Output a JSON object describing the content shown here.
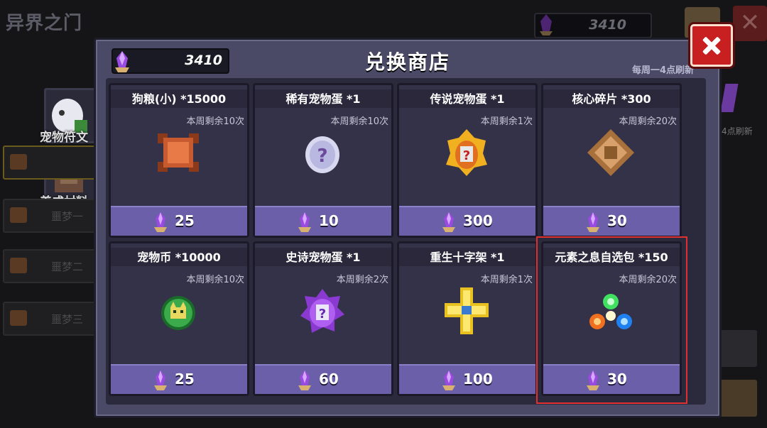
{
  "background": {
    "title": "异界之门",
    "currency_value": "3410",
    "side_menu": [
      {
        "label": "宠物符文"
      },
      {
        "label": "养成材料"
      }
    ],
    "side_tabs": [
      {
        "label": "噩梦一"
      },
      {
        "label": "噩梦二"
      },
      {
        "label": "噩梦三"
      }
    ],
    "right_note": "4点刷新"
  },
  "shop": {
    "title": "兑换商店",
    "currency_value": "3410",
    "refresh_note": "每周一4点刷新",
    "close_icon": "close-icon",
    "items": [
      {
        "name": "狗粮(小) *15000",
        "remain": "本周剩余10次",
        "price": "25",
        "icon": "dog-food-icon"
      },
      {
        "name": "稀有宠物蛋 *1",
        "remain": "本周剩余10次",
        "price": "10",
        "icon": "rare-egg-icon"
      },
      {
        "name": "传说宠物蛋 *1",
        "remain": "本周剩余1次",
        "price": "300",
        "icon": "legendary-egg-icon"
      },
      {
        "name": "核心碎片 *300",
        "remain": "本周剩余20次",
        "price": "30",
        "icon": "core-fragment-icon"
      },
      {
        "name": "宠物币 *10000",
        "remain": "本周剩余10次",
        "price": "25",
        "icon": "pet-coin-icon"
      },
      {
        "name": "史诗宠物蛋 *1",
        "remain": "本周剩余2次",
        "price": "60",
        "icon": "epic-egg-icon"
      },
      {
        "name": "重生十字架 *1",
        "remain": "本周剩余1次",
        "price": "100",
        "icon": "rebirth-cross-icon"
      },
      {
        "name": "元素之息自选包 *150",
        "remain": "本周剩余20次",
        "price": "30",
        "icon": "element-pack-icon"
      }
    ]
  },
  "colors": {
    "accent_red": "#c82020",
    "price_bar": "#6a5fa8",
    "panel": "#4a4a66"
  }
}
